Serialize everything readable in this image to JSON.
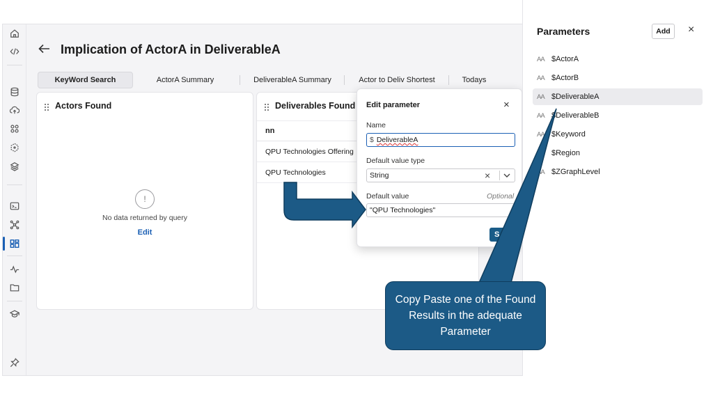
{
  "page": {
    "title": "Implication of ActorA in DeliverableA"
  },
  "tabs": [
    {
      "label": "KeyWord Search",
      "active": true
    },
    {
      "label": "ActorA Summary",
      "active": false
    },
    {
      "label": "DeliverableA Summary",
      "active": false
    },
    {
      "label": "Actor to Deliv Shortest",
      "active": false
    },
    {
      "label": "Todays",
      "active": false
    }
  ],
  "actors_card": {
    "title": "Actors Found",
    "empty_icon": "!",
    "empty_text": "No data returned by query",
    "edit_label": "Edit"
  },
  "deliverables_card": {
    "title": "Deliverables Found",
    "column": "nn",
    "rows": [
      "QPU Technologies Offering",
      "QPU Technologies"
    ]
  },
  "edit_parameter": {
    "title": "Edit parameter",
    "close_icon": "×",
    "name_label": "Name",
    "name_prefix": "$",
    "name_value": "DeliverableA",
    "type_label": "Default value type",
    "type_value": "String",
    "clear_icon": "×",
    "default_label": "Default value",
    "optional_label": "Optional",
    "default_value": "\"QPU Technologies\"",
    "save_label": "S"
  },
  "parameters_panel": {
    "title": "Parameters",
    "add_label": "Add",
    "close_icon": "×",
    "icon_glyph": "AA",
    "items": [
      {
        "label": "$ActorA",
        "selected": false
      },
      {
        "label": "$ActorB",
        "selected": false
      },
      {
        "label": "$DeliverableA",
        "selected": true
      },
      {
        "label": "$DeliverableB",
        "selected": false
      },
      {
        "label": "$Keyword",
        "selected": false
      },
      {
        "label": "$Region",
        "selected": false
      },
      {
        "label": "$ZGraphLevel",
        "selected": false
      }
    ]
  },
  "callout": {
    "text": "Copy Paste one of the Found Results in the adequate Parameter"
  },
  "colors": {
    "accent": "#1a5fb4",
    "callout_fill": "#1c5a86",
    "save_button": "#1a5c88"
  },
  "rail_icons": [
    "home-icon",
    "code-icon",
    "database-icon",
    "cloud-upload-icon",
    "apps-icon",
    "hexagon-icon",
    "layers-icon",
    "terminal-icon",
    "graph-icon",
    "dashboard-icon",
    "activity-icon",
    "folder-icon",
    "learn-icon",
    "pin-icon"
  ]
}
